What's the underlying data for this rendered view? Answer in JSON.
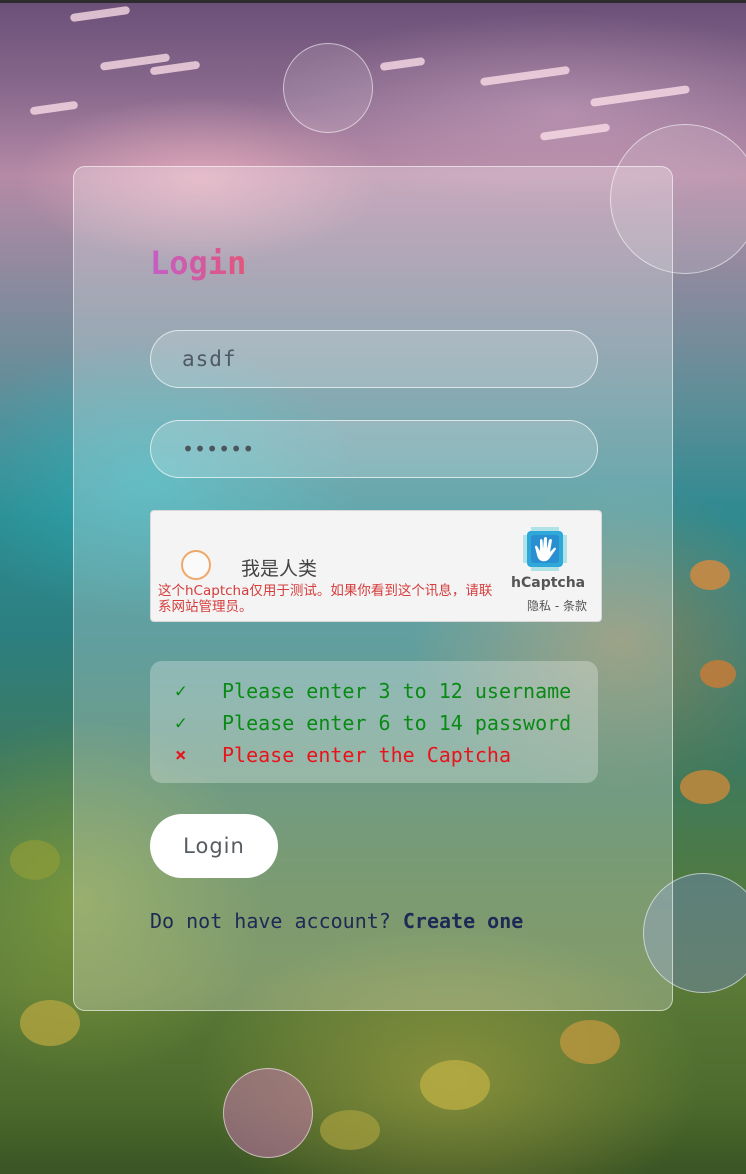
{
  "title": "Login",
  "form": {
    "username_value": "asdf",
    "password_masked": "••••••"
  },
  "captcha": {
    "checkbox_label": "我是人类",
    "warning_text": "这个hCaptcha仅用于测试。如果你看到这个讯息，请联系网站管理员。",
    "brand": "hCaptcha",
    "privacy_link": "隐私",
    "separator": " - ",
    "terms_link": "条款"
  },
  "validation": [
    {
      "status": "ok",
      "icon": "✓",
      "message": "Please enter 3 to 12 username"
    },
    {
      "status": "ok",
      "icon": "✓",
      "message": "Please enter 6 to 14 password"
    },
    {
      "status": "error",
      "icon": "×",
      "message": "Please enter the Captcha"
    }
  ],
  "login_button": "Login",
  "footer": {
    "prompt": "Do not have account? ",
    "link": "Create one"
  },
  "colors": {
    "title_gradient_start": "#c45fc7",
    "title_gradient_end": "#e2557a",
    "ok": "#088a14",
    "error": "#e8141c",
    "captcha_warning": "#d63c3c",
    "footer_text": "#1c2a55"
  },
  "icons": {
    "captcha_logo": "hcaptcha-hand-icon",
    "validation_ok": "checkmark-icon",
    "validation_error": "cross-icon"
  }
}
